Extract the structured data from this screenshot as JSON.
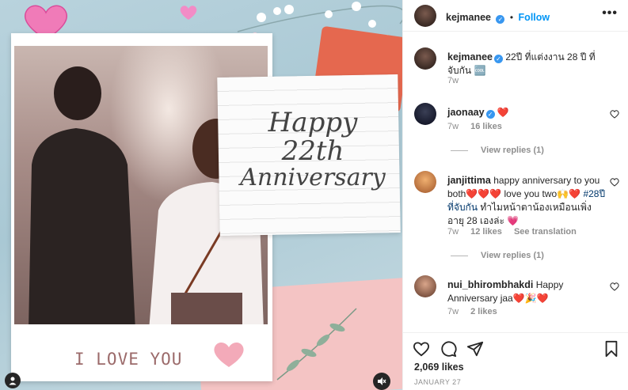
{
  "post": {
    "media_text": {
      "line1": "Happy",
      "line2": "22th",
      "line3": "Anniversary",
      "bottom": "I LOVE YOU"
    }
  },
  "header": {
    "username": "kejmanee",
    "separator": "•",
    "follow_label": "Follow",
    "more_label": "•••"
  },
  "caption": {
    "username": "kejmanee",
    "text": "22ปี ที่แต่งงาน 28 ปี ที่จับกัน 🆒",
    "time": "7w"
  },
  "comments": [
    {
      "username": "jaonaay",
      "text": "❤️",
      "time": "7w",
      "likes": "16 likes",
      "replies": "View replies (1)"
    },
    {
      "username": "janjittima",
      "text": "happy anniversary to you both❤️❤️❤️ love you two🙌❤️",
      "hashtag": "#28ปีที่จับกัน",
      "text2": "ทำไมหน้าตาน้องเหมือนเพิ่งอายุ 28 เองล่ะ 💗",
      "time": "7w",
      "likes": "12 likes",
      "translate": "See translation",
      "replies": "View replies (1)"
    },
    {
      "username": "nui_bhirombhakdi",
      "text": "Happy Anniversary jaa❤️🎉❤️",
      "time": "7w",
      "likes": "2 likes"
    }
  ],
  "stats": {
    "likes": "2,069 likes",
    "date": "January 27"
  },
  "colors": {
    "accent": "#0095f6",
    "verified": "#3897f0",
    "muted": "#8e8e8e",
    "text": "#262626",
    "heart": "#ed4956"
  },
  "icons": [
    "heart-icon",
    "comment-icon",
    "share-icon",
    "bookmark-icon",
    "more-icon",
    "verified-icon",
    "mute-icon",
    "user-icon"
  ]
}
